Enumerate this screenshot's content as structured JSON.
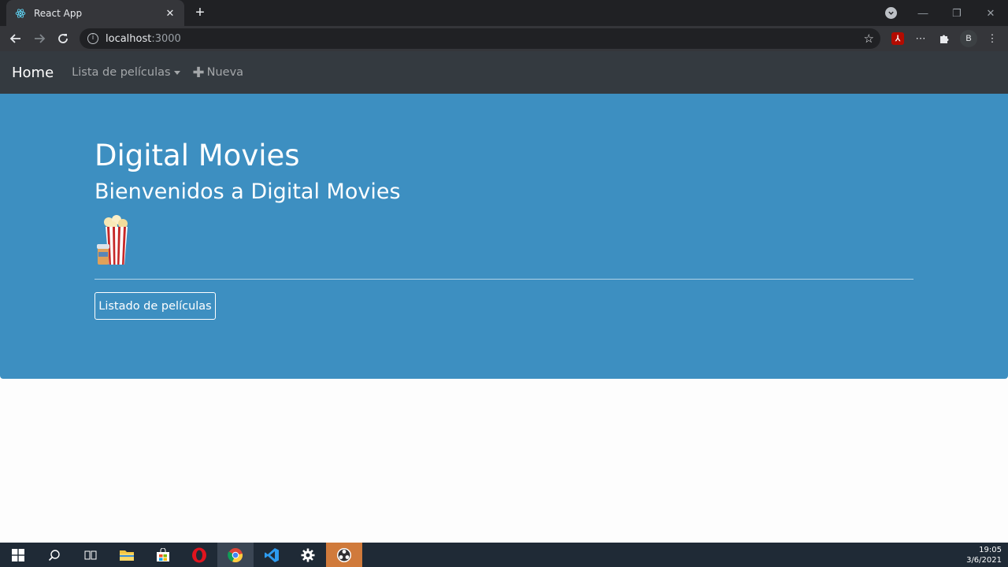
{
  "browser": {
    "tab_title": "React App",
    "tab_close": "✕",
    "new_tab": "+",
    "url_host": "localhost",
    "url_port": ":3000",
    "profile_initial": "B",
    "minimize": "—",
    "maximize": "❐",
    "close": "✕"
  },
  "navbar": {
    "brand": "Home",
    "dropdown_label": "Lista de películas",
    "new_label": "Nueva"
  },
  "jumbotron": {
    "title": "Digital Movies",
    "subtitle": "Bienvenidos a Digital Movies",
    "button_label": "Listado de películas"
  },
  "taskbar": {
    "time": "19:05",
    "date": "3/6/2021"
  },
  "colors": {
    "jumbotron_bg": "#3d8fc1",
    "navbar_bg": "#343a40"
  }
}
